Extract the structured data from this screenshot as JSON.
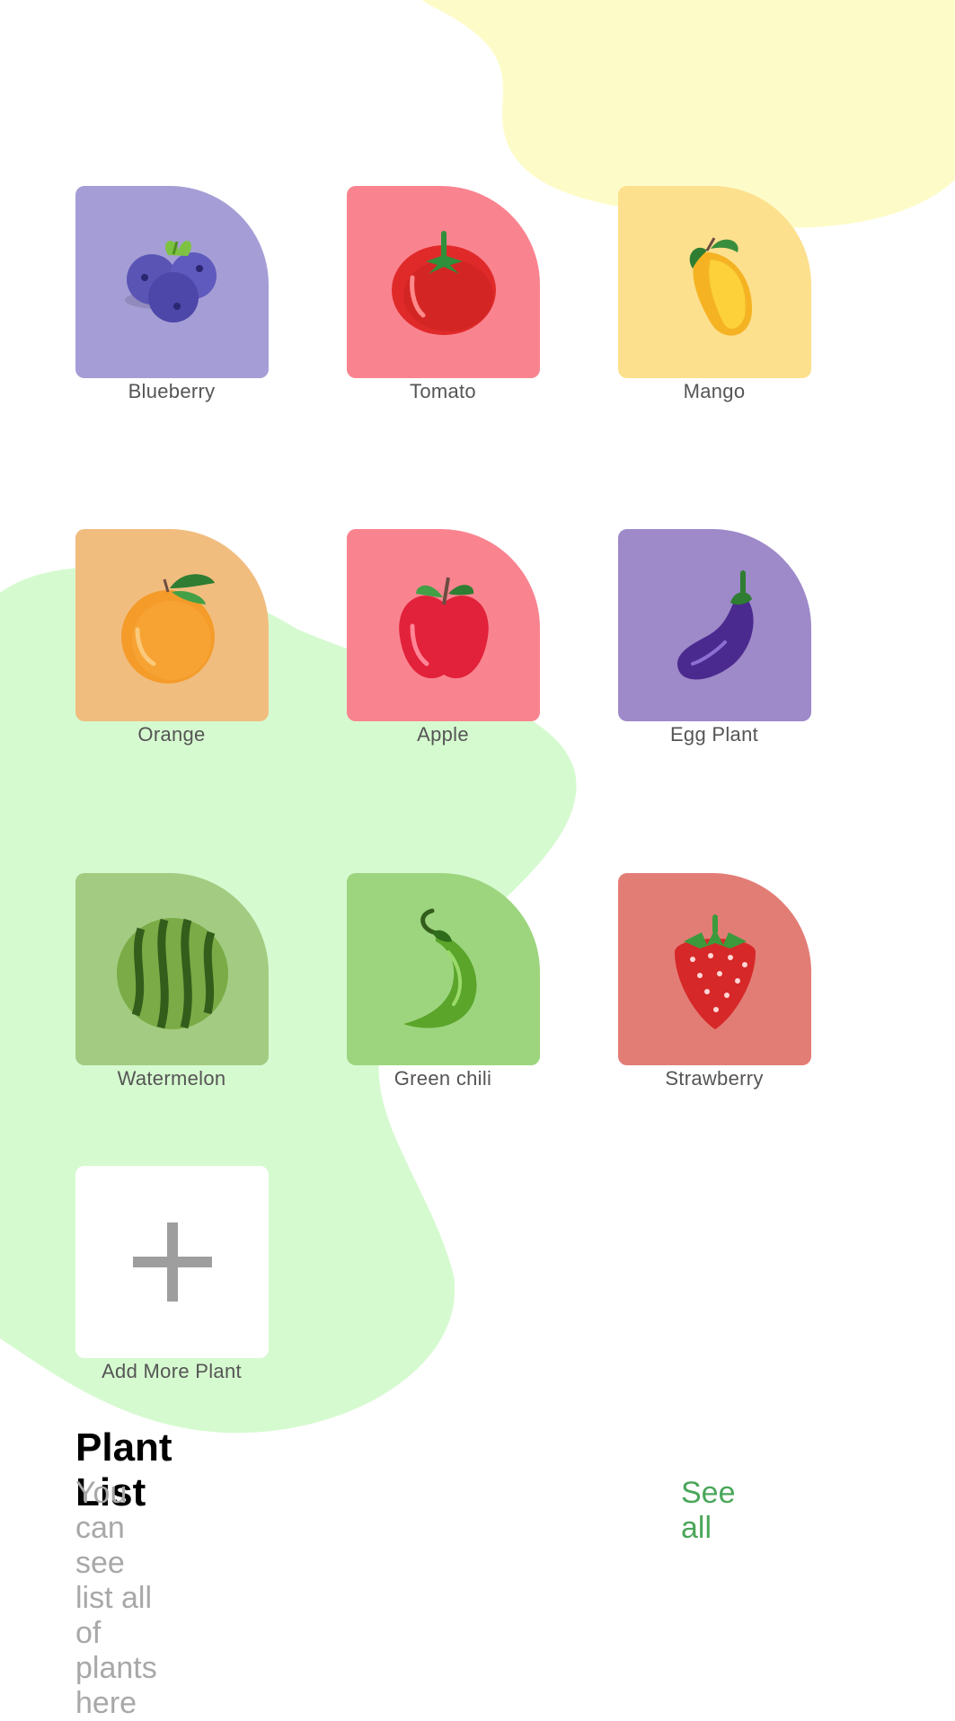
{
  "plants": [
    {
      "label": "Blueberry",
      "icon": "blueberry-icon",
      "color": "#a59ed6"
    },
    {
      "label": "Tomato",
      "icon": "tomato-icon",
      "color": "#f98490"
    },
    {
      "label": "Mango",
      "icon": "mango-icon",
      "color": "#fde08e"
    },
    {
      "label": "Orange",
      "icon": "orange-icon",
      "color": "#f1bd7f"
    },
    {
      "label": "Apple",
      "icon": "apple-icon",
      "color": "#f98490"
    },
    {
      "label": "Egg Plant",
      "icon": "eggplant-icon",
      "color": "#9e89c9"
    },
    {
      "label": "Watermelon",
      "icon": "watermelon-icon",
      "color": "#a3cc82"
    },
    {
      "label": "Green chili",
      "icon": "chili-icon",
      "color": "#9dd57f"
    },
    {
      "label": "Strawberry",
      "icon": "strawberry-icon",
      "color": "#e27d76"
    }
  ],
  "add_plant": {
    "label": "Add More Plant",
    "icon": "plus-icon"
  },
  "plant_list": {
    "title": "Plant List",
    "subtitle": "You can see list all of plants here",
    "see_all": "See all"
  },
  "colors": {
    "background": "#ffffff",
    "yellow_blob": "#fdfcc8",
    "green_blob": "#d6fad0",
    "accent": "#4aa65a"
  }
}
